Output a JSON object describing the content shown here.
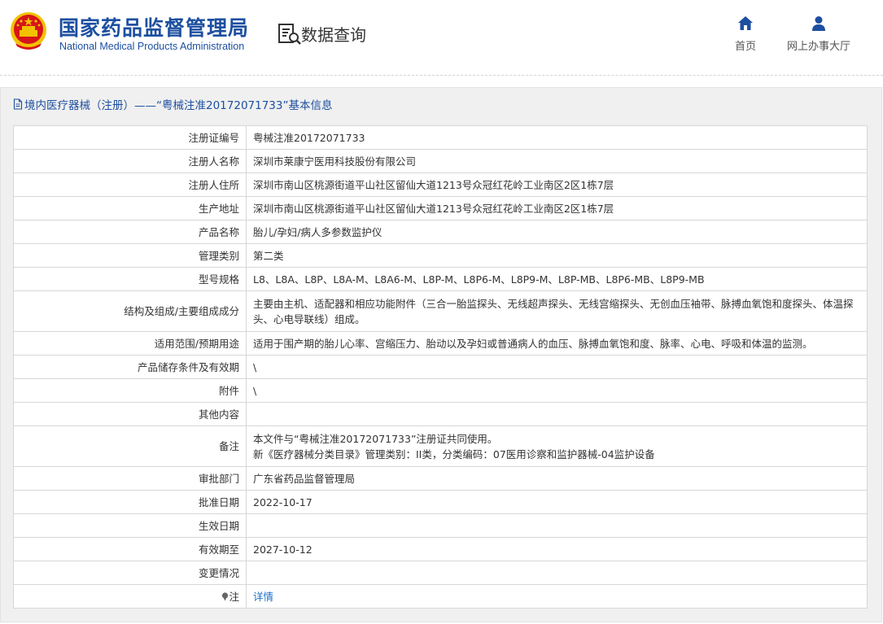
{
  "header": {
    "site_title": "国家药品监督管理局",
    "site_subtitle": "National Medical Products Administration",
    "section_title": "数据查询",
    "nav": [
      {
        "label": "首页",
        "icon": "home-icon"
      },
      {
        "label": "网上办事大厅",
        "icon": "user-icon"
      }
    ]
  },
  "breadcrumb": "境内医疗器械（注册）——“粤械注准20172071733”基本信息",
  "rows": [
    {
      "label": "注册证编号",
      "value": "粤械注准20172071733"
    },
    {
      "label": "注册人名称",
      "value": "深圳市莱康宁医用科技股份有限公司"
    },
    {
      "label": "注册人住所",
      "value": "深圳市南山区桃源街道平山社区留仙大道1213号众冠红花岭工业南区2区1栋7层"
    },
    {
      "label": "生产地址",
      "value": "深圳市南山区桃源街道平山社区留仙大道1213号众冠红花岭工业南区2区1栋7层"
    },
    {
      "label": "产品名称",
      "value": "胎儿/孕妇/病人多参数监护仪"
    },
    {
      "label": "管理类别",
      "value": "第二类"
    },
    {
      "label": "型号规格",
      "value": "L8、L8A、L8P、L8A-M、L8A6-M、L8P-M、L8P6-M、L8P9-M、L8P-MB、L8P6-MB、L8P9-MB"
    },
    {
      "label": "结构及组成/主要组成成分",
      "value": "主要由主机、适配器和相应功能附件（三合一胎监探头、无线超声探头、无线宫缩探头、无创血压袖带、脉搏血氧饱和度探头、体温探头、心电导联线）组成。"
    },
    {
      "label": "适用范围/预期用途",
      "value": "适用于围产期的胎儿心率、宫缩压力、胎动以及孕妇或普通病人的血压、脉搏血氧饱和度、脉率、心电、呼吸和体温的监测。"
    },
    {
      "label": "产品储存条件及有效期",
      "value": "\\"
    },
    {
      "label": "附件",
      "value": "\\"
    },
    {
      "label": "其他内容",
      "value": ""
    },
    {
      "label": "备注",
      "value_line1": "本文件与“粤械注准20172071733”注册证共同使用。",
      "value_line2": "新《医疗器械分类目录》管理类别：II类，分类编码：07医用诊察和监护器械-04监护设备"
    },
    {
      "label": "审批部门",
      "value": "广东省药品监督管理局"
    },
    {
      "label": "批准日期",
      "value": "2022-10-17"
    },
    {
      "label": "生效日期",
      "value": ""
    },
    {
      "label": "有效期至",
      "value": "2027-10-12"
    },
    {
      "label": "变更情况",
      "value": ""
    },
    {
      "label": "注",
      "value": "详情"
    }
  ],
  "colors": {
    "brand_blue": "#1d4fa0",
    "link_blue": "#1d6fc8",
    "panel_bg": "#f0f0f0",
    "emblem_red": "#d7141a",
    "emblem_gold": "#f2c200"
  }
}
